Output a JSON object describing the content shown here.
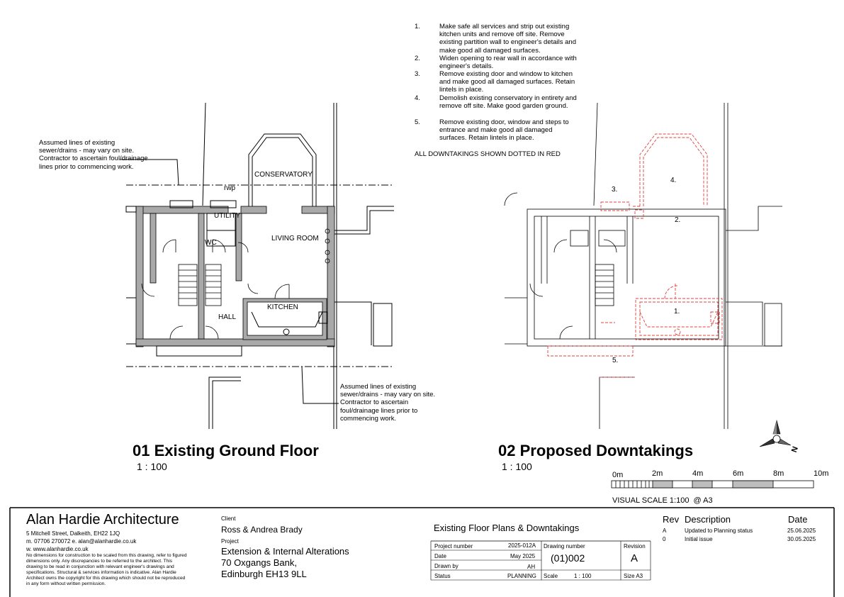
{
  "drawing1": {
    "title": "01 Existing Ground Floor",
    "scale": "1 : 100",
    "rooms": {
      "conservatory": "CONSERVATORY",
      "rwp": "rwp",
      "utility": "UTILITY",
      "wc": "WC",
      "living": "LIVING ROOM",
      "kitchen": "KITCHEN",
      "hall": "HALL"
    },
    "note_drains_top": "Assumed lines of existing sewer/drains - may vary on site. Contractor to ascertain foul/drainage lines prior to commencing work.",
    "note_drains_bottom": "Assumed lines of existing sewer/drains - may vary on site. Contractor to ascertain foul/drainage lines prior to commencing work."
  },
  "drawing2": {
    "title": "02 Proposed Downtakings",
    "scale": "1 : 100",
    "markers": [
      "1.",
      "2.",
      "3.",
      "4.",
      "5."
    ]
  },
  "downtakings": {
    "items": [
      {
        "num": "1.",
        "text": "Make safe all services and strip out existing kitchen units and remove off site. Remove existing partition wall to engineer's details and make good all damaged surfaces."
      },
      {
        "num": "2.",
        "text": "Widen opening to rear wall in accordance with engineer's details."
      },
      {
        "num": "3.",
        "text": "Remove existing door and window to kitchen and make good all damaged surfaces. Retain lintels in place."
      },
      {
        "num": "4.",
        "text": "Demolish existing conservatory in entirety and remove off site. Make good garden ground."
      },
      {
        "num": "5.",
        "text": "Remove existing door, window and steps to entrance and make good all damaged surfaces. Retain lintels in place."
      }
    ],
    "footer": "ALL DOWNTAKINGS SHOWN DOTTED IN RED"
  },
  "north": "N",
  "scale_bar": {
    "labels": [
      "0m",
      "2m",
      "4m",
      "6m",
      "8m",
      "10m"
    ],
    "caption": "VISUAL SCALE 1:100  @ A3"
  },
  "title_block": {
    "firm": "Alan Hardie Architecture",
    "address": "5 Mitchell Street, Dalkeith, EH22 1JQ",
    "contact": "m. 07706 270072 e. alan@alanhardie.co.uk",
    "web": "w. www.alanhardie.co.uk",
    "disclaimer": "No dimensions for construction to be scaled from this drawing, refer to figured dimensions only. Any discrepancies to be referred to the architect. This drawing to be read in conjunction with relevant engineer's drawings and specifications. Structural & services information is indicative. Alan Hardie Architect owns the copyright for this drawing which should not be reproduced in any form without written permission.",
    "client_label": "Client",
    "client": "Ross & Andrea Brady",
    "project_label": "Project",
    "project_lines": [
      "Extension & Internal Alterations",
      "70 Oxgangs Bank,",
      "Edinburgh EH13 9LL"
    ],
    "sheet_title": "Existing Floor Plans & Downtakings",
    "project_number_label": "Project number",
    "project_number": "2025-012A",
    "date_label": "Date",
    "date": "May 2025",
    "drawn_by_label": "Drawn by",
    "drawn_by": "AH",
    "status_label": "Status",
    "status": "PLANNING",
    "drawing_number_label": "Drawing number",
    "drawing_number": "(01)002",
    "revision_label": "Revision",
    "revision": "A",
    "scale_label": "Scale",
    "scale": "1 : 100",
    "size": "Size A3",
    "revisions_header": {
      "rev": "Rev",
      "desc": "Description",
      "date": "Date"
    },
    "revisions": [
      {
        "rev": "A",
        "desc": "Updated to Planning status",
        "date": "25.06.2025"
      },
      {
        "rev": "0",
        "desc": "Initial issue",
        "date": "30.05.2025"
      }
    ]
  },
  "colors": {
    "wall": "#a9a9a9",
    "demolition": "#e0413c",
    "line": "#000000"
  }
}
